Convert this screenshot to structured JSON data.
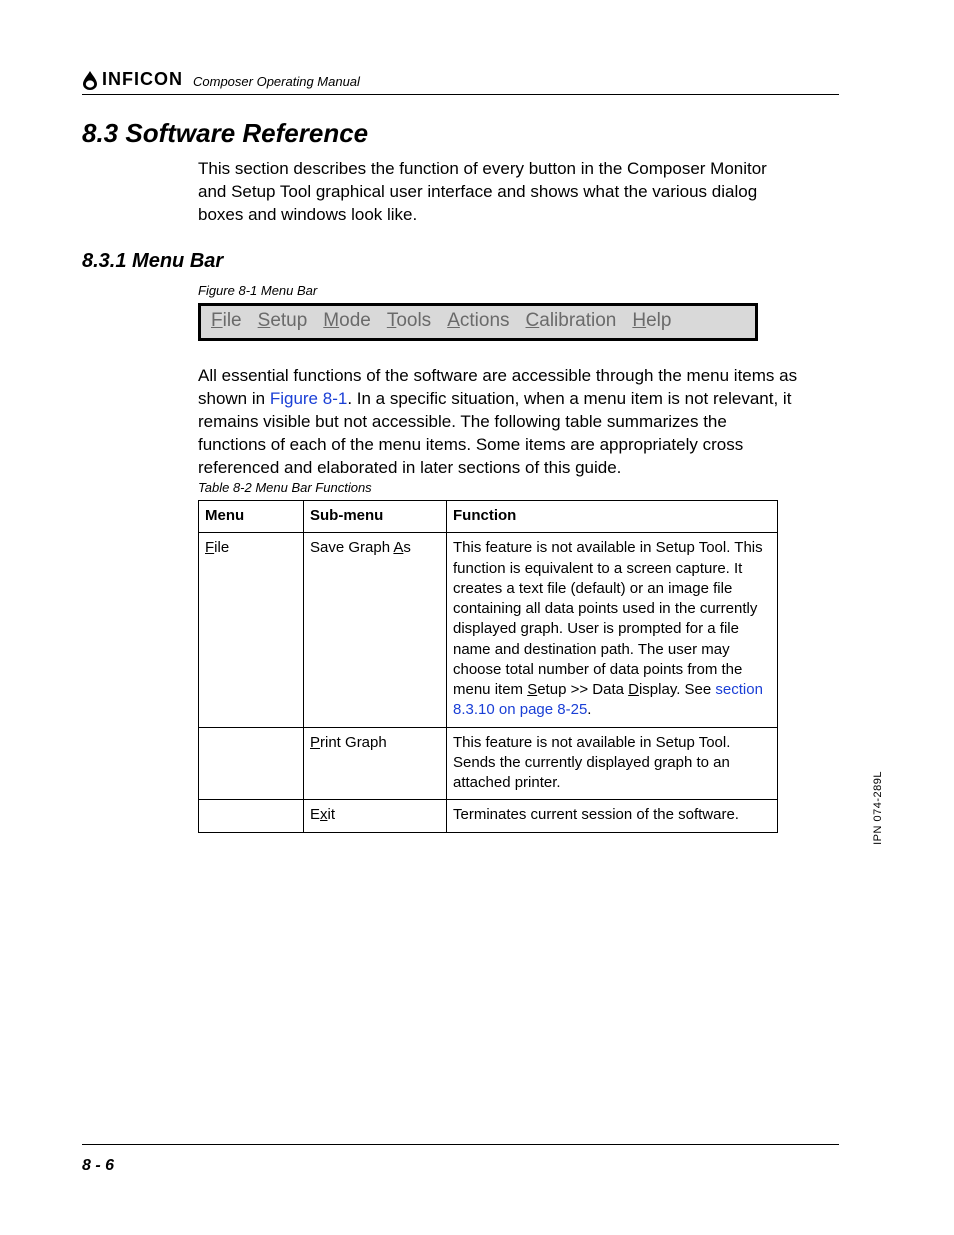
{
  "header": {
    "brand": "INFICON",
    "title": "Composer Operating Manual"
  },
  "h1": "8.3  Software Reference",
  "intro": "This section describes the function of every button in the Composer Monitor and Setup Tool graphical user interface and shows what the various dialog boxes and windows look like.",
  "h2": "8.3.1  Menu Bar",
  "figure_caption": "Figure 8-1  Menu Bar",
  "menu": {
    "items": [
      {
        "u": "F",
        "rest": "ile"
      },
      {
        "u": "S",
        "rest": "etup"
      },
      {
        "u": "M",
        "rest": "ode"
      },
      {
        "u": "T",
        "rest": "ools"
      },
      {
        "u": "A",
        "rest": "ctions"
      },
      {
        "u": "C",
        "rest": "alibration"
      },
      {
        "u": "H",
        "rest": "elp"
      }
    ]
  },
  "after_fig": {
    "pre": "All essential functions of the software are accessible through the menu items as shown in ",
    "xref": "Figure 8-1",
    "post": ". In a specific situation, when a menu item is not relevant, it remains visible but not accessible. The following table summarizes the functions of each of the menu items. Some items are appropriately cross referenced and elaborated in later sections of this guide."
  },
  "table_caption": "Table 8-2  Menu Bar Functions",
  "table": {
    "headers": [
      "Menu",
      "Sub-menu",
      "Function"
    ],
    "rows": [
      {
        "menu_u": "F",
        "menu_rest": "ile",
        "sub_pre": "Save Graph ",
        "sub_u": "A",
        "sub_post": "s",
        "func_pre": "This feature is not available in Setup Tool. This function is equivalent to a screen capture. It creates a text file (default) or an image file containing all data points used in the currently displayed graph. User is prompted for a file name and destination path. The user may choose total number of data points from the menu item ",
        "func_u1": "S",
        "func_mid1": "etup >> Data ",
        "func_u2": "D",
        "func_mid2": "isplay. See ",
        "func_xref": "section 8.3.10 on page 8-25",
        "func_post": "."
      },
      {
        "menu_u": "",
        "menu_rest": "",
        "sub_pre": "",
        "sub_u": "P",
        "sub_post": "rint Graph",
        "func_pre": "This feature is not available in Setup Tool. Sends the currently displayed graph to an attached printer.",
        "func_u1": "",
        "func_mid1": "",
        "func_u2": "",
        "func_mid2": "",
        "func_xref": "",
        "func_post": ""
      },
      {
        "menu_u": "",
        "menu_rest": "",
        "sub_pre": "E",
        "sub_u": "x",
        "sub_post": "it",
        "func_pre": "Terminates current session of the software.",
        "func_u1": "",
        "func_mid1": "",
        "func_u2": "",
        "func_mid2": "",
        "func_xref": "",
        "func_post": ""
      }
    ]
  },
  "side_text": "IPN 074-289L",
  "footer_page": "8 - 6"
}
